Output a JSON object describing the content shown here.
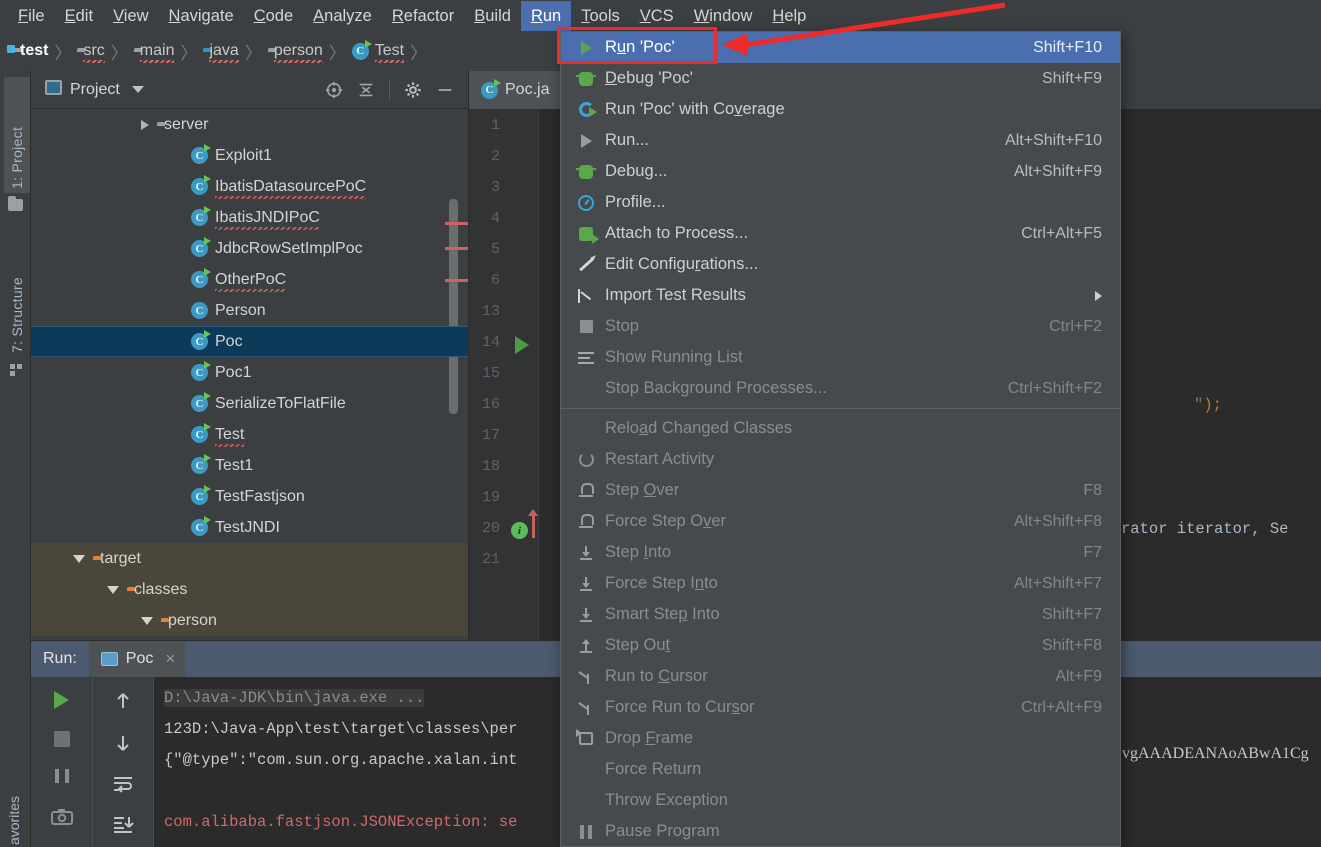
{
  "menubar": {
    "items": [
      {
        "label": "File",
        "mn": "F"
      },
      {
        "label": "Edit",
        "mn": "E"
      },
      {
        "label": "View",
        "mn": "V"
      },
      {
        "label": "Navigate",
        "mn": "N"
      },
      {
        "label": "Code",
        "mn": "C"
      },
      {
        "label": "Analyze",
        "mn": "A"
      },
      {
        "label": "Refactor",
        "mn": "R"
      },
      {
        "label": "Build",
        "mn": "B"
      },
      {
        "label": "Run",
        "mn": "R"
      },
      {
        "label": "Tools",
        "mn": "T"
      },
      {
        "label": "VCS",
        "mn": "V"
      },
      {
        "label": "Window",
        "mn": "W"
      },
      {
        "label": "Help",
        "mn": "H"
      }
    ],
    "active_index": 8
  },
  "breadcrumb": {
    "items": [
      {
        "label": "test",
        "icon": "folder-module-icon"
      },
      {
        "label": "src",
        "icon": "folder-icon"
      },
      {
        "label": "main",
        "icon": "folder-icon"
      },
      {
        "label": "java",
        "icon": "folder-source-icon"
      },
      {
        "label": "person",
        "icon": "folder-package-icon"
      },
      {
        "label": "Test",
        "icon": "java-class-icon"
      }
    ]
  },
  "left_toolbar": {
    "tabs": [
      {
        "label": "1: Project",
        "icon": "project-icon"
      },
      {
        "label": "7: Structure",
        "icon": "structure-icon"
      }
    ],
    "favorites_label": "avorites"
  },
  "project_panel": {
    "title": "Project",
    "dropdown_icon": "chevron-down-icon",
    "toolbar_icons": [
      "locate-icon",
      "collapse-all-icon",
      "settings-gear-icon",
      "hide-icon"
    ],
    "tree": [
      {
        "label": "server",
        "kind": "folder-package",
        "indent": 3,
        "twisty": "right",
        "selected": false
      },
      {
        "label": "Exploit1",
        "kind": "class-run",
        "indent": 4,
        "twisty": "none",
        "selected": false
      },
      {
        "label": "IbatisDatasourcePoC",
        "kind": "class-run",
        "indent": 4,
        "twisty": "none",
        "selected": false,
        "squiggle": true
      },
      {
        "label": "IbatisJNDIPoC",
        "kind": "class-run",
        "indent": 4,
        "twisty": "none",
        "selected": false,
        "squiggle": true
      },
      {
        "label": "JdbcRowSetImplPoc",
        "kind": "class-run",
        "indent": 4,
        "twisty": "none",
        "selected": false
      },
      {
        "label": "OtherPoC",
        "kind": "class-run",
        "indent": 4,
        "twisty": "none",
        "selected": false,
        "squiggle": true
      },
      {
        "label": "Person",
        "kind": "class",
        "indent": 4,
        "twisty": "none",
        "selected": false
      },
      {
        "label": "Poc",
        "kind": "class-run",
        "indent": 4,
        "twisty": "none",
        "selected": true
      },
      {
        "label": "Poc1",
        "kind": "class-run",
        "indent": 4,
        "twisty": "none",
        "selected": false
      },
      {
        "label": "SerializeToFlatFile",
        "kind": "class-run",
        "indent": 4,
        "twisty": "none",
        "selected": false
      },
      {
        "label": "Test",
        "kind": "class-run",
        "indent": 4,
        "twisty": "none",
        "selected": false,
        "squiggle": true
      },
      {
        "label": "Test1",
        "kind": "class-run",
        "indent": 4,
        "twisty": "none",
        "selected": false
      },
      {
        "label": "TestFastjson",
        "kind": "class-run",
        "indent": 4,
        "twisty": "none",
        "selected": false
      },
      {
        "label": "TestJNDI",
        "kind": "class-run",
        "indent": 4,
        "twisty": "none",
        "selected": false
      },
      {
        "label": "target",
        "kind": "folder-orange",
        "indent": 1,
        "twisty": "down",
        "selected": false,
        "highlight": true
      },
      {
        "label": "classes",
        "kind": "folder-orange",
        "indent": 2,
        "twisty": "down",
        "selected": false,
        "highlight": true
      },
      {
        "label": "person",
        "kind": "folder-orange",
        "indent": 3,
        "twisty": "down",
        "selected": false,
        "highlight": true
      }
    ]
  },
  "editor": {
    "tab": {
      "label": "Poc.ja",
      "icon": "java-class-icon"
    },
    "line_numbers": [
      "1",
      "2",
      "3",
      "4",
      "5",
      "6",
      "13",
      "14",
      "15",
      "16",
      "17",
      "18",
      "19",
      "20",
      "21"
    ],
    "gutter_markers": [
      {
        "type": "run-arrow-icon",
        "line": "14"
      },
      {
        "type": "intention-bulb-icon",
        "line": "20"
      },
      {
        "type": "up-arrow-icon",
        "line": "20"
      }
    ],
    "code_fragments": [
      {
        "text": "\");",
        "line": "16"
      },
      {
        "text": "rator iterator, Se",
        "line": "20"
      }
    ]
  },
  "run_menu": {
    "items": [
      {
        "label": "Run 'Poc'",
        "mn_prefix": "R",
        "mn_char": "u",
        "mn_rest": "n 'Poc'",
        "key": "Shift+F10",
        "icon": "run-icon",
        "state": "highlight"
      },
      {
        "label": "Debug 'Poc'",
        "mn_prefix": "",
        "mn_char": "D",
        "mn_rest": "ebug 'Poc'",
        "key": "Shift+F9",
        "icon": "debug-icon",
        "state": "normal"
      },
      {
        "label": "Run 'Poc' with Coverage",
        "mn_prefix": "Run 'Poc' with Co",
        "mn_char": "v",
        "mn_rest": "erage",
        "key": "",
        "icon": "coverage-icon",
        "state": "normal"
      },
      {
        "label": "Run...",
        "mn_prefix": "Run...",
        "mn_char": "",
        "mn_rest": "",
        "key": "Alt+Shift+F10",
        "icon": "run-plain-icon",
        "state": "normal"
      },
      {
        "label": "Debug...",
        "mn_prefix": "Debug...",
        "mn_char": "",
        "mn_rest": "",
        "key": "Alt+Shift+F9",
        "icon": "debug-icon",
        "state": "normal"
      },
      {
        "label": "Profile...",
        "mn_prefix": "Profile...",
        "mn_char": "",
        "mn_rest": "",
        "key": "",
        "icon": "profile-icon",
        "state": "normal"
      },
      {
        "label": "Attach to Process...",
        "mn_prefix": "Attach to Process...",
        "mn_char": "",
        "mn_rest": "",
        "key": "Ctrl+Alt+F5",
        "icon": "attach-process-icon",
        "state": "normal"
      },
      {
        "label": "Edit Configurations...",
        "mn_prefix": "Edit Configu",
        "mn_char": "r",
        "mn_rest": "ations...",
        "key": "",
        "icon": "edit-pencil-icon",
        "state": "normal"
      },
      {
        "label": "Import Test Results",
        "mn_prefix": "Import Test Results",
        "mn_char": "",
        "mn_rest": "",
        "key": "",
        "icon": "import-results-icon",
        "state": "normal",
        "submenu": true
      },
      {
        "label": "Stop",
        "mn_prefix": "Stop",
        "mn_char": "",
        "mn_rest": "",
        "key": "Ctrl+F2",
        "icon": "stop-icon",
        "state": "disabled"
      },
      {
        "label": "Show Running List",
        "mn_prefix": "Show Running List",
        "mn_char": "",
        "mn_rest": "",
        "key": "",
        "icon": "running-list-icon",
        "state": "disabled"
      },
      {
        "label": "Stop Background Processes...",
        "mn_prefix": "Stop Background Processes...",
        "mn_char": "",
        "mn_rest": "",
        "key": "Ctrl+Shift+F2",
        "icon": "none",
        "state": "disabled"
      },
      {
        "separator": true
      },
      {
        "label": "Reload Changed Classes",
        "mn_prefix": "Relo",
        "mn_char": "a",
        "mn_rest": "d Changed Classes",
        "key": "",
        "icon": "none",
        "state": "disabled"
      },
      {
        "label": "Restart Activity",
        "mn_prefix": "Restart Activity",
        "mn_char": "",
        "mn_rest": "",
        "key": "",
        "icon": "restart-icon",
        "state": "disabled"
      },
      {
        "label": "Step Over",
        "mn_prefix": "Step ",
        "mn_char": "O",
        "mn_rest": "ver",
        "key": "F8",
        "icon": "step-over-icon",
        "state": "disabled"
      },
      {
        "label": "Force Step Over",
        "mn_prefix": "Force Step O",
        "mn_char": "v",
        "mn_rest": "er",
        "key": "Alt+Shift+F8",
        "icon": "step-over-icon",
        "state": "disabled"
      },
      {
        "label": "Step Into",
        "mn_prefix": "Step ",
        "mn_char": "I",
        "mn_rest": "nto",
        "key": "F7",
        "icon": "step-into-icon",
        "state": "disabled"
      },
      {
        "label": "Force Step Into",
        "mn_prefix": "Force Step I",
        "mn_char": "n",
        "mn_rest": "to",
        "key": "Alt+Shift+F7",
        "icon": "step-into-icon",
        "state": "disabled"
      },
      {
        "label": "Smart Step Into",
        "mn_prefix": "Smart Ste",
        "mn_char": "p",
        "mn_rest": " Into",
        "key": "Shift+F7",
        "icon": "smart-step-into-icon",
        "state": "disabled"
      },
      {
        "label": "Step Out",
        "mn_prefix": "Step Ou",
        "mn_char": "t",
        "mn_rest": "",
        "key": "Shift+F8",
        "icon": "step-out-icon",
        "state": "disabled"
      },
      {
        "label": "Run to Cursor",
        "mn_prefix": "Run to ",
        "mn_char": "C",
        "mn_rest": "ursor",
        "key": "Alt+F9",
        "icon": "run-to-cursor-icon",
        "state": "disabled"
      },
      {
        "label": "Force Run to Cursor",
        "mn_prefix": "Force Run to Cur",
        "mn_char": "s",
        "mn_rest": "or",
        "key": "Ctrl+Alt+F9",
        "icon": "run-to-cursor-icon",
        "state": "disabled"
      },
      {
        "label": "Drop Frame",
        "mn_prefix": "Drop ",
        "mn_char": "F",
        "mn_rest": "rame",
        "key": "",
        "icon": "drop-frame-icon",
        "state": "disabled"
      },
      {
        "label": "Force Return",
        "mn_prefix": "Force Return",
        "mn_char": "",
        "mn_rest": "",
        "key": "",
        "icon": "none",
        "state": "disabled"
      },
      {
        "label": "Throw Exception",
        "mn_prefix": "Throw Exception",
        "mn_char": "",
        "mn_rest": "",
        "key": "",
        "icon": "none",
        "state": "disabled"
      },
      {
        "label": "Pause Program",
        "mn_prefix": "Pause Program",
        "mn_char": "",
        "mn_rest": "",
        "key": "",
        "icon": "pause-icon",
        "state": "disabled"
      }
    ]
  },
  "run_tool_window": {
    "label": "Run:",
    "tab": {
      "label": "Poc",
      "icon": "run-config-icon",
      "close": "×"
    },
    "toolbar_left": [
      "rerun-icon",
      "stop-icon",
      "pause-icon",
      "screenshot-icon"
    ],
    "toolbar_right": [
      "up-arrow-icon",
      "down-arrow-icon",
      "soft-wrap-icon",
      "scroll-to-end-icon"
    ],
    "console_lines": [
      {
        "text": "D:\\Java-JDK\\bin\\java.exe ...",
        "style": "cmd"
      },
      {
        "text": "123D:\\Java-App\\test\\target\\classes\\per",
        "style": "white"
      },
      {
        "text": "{\"@type\":\"com.sun.org.apache.xalan.int",
        "style": "white"
      },
      {
        "text": "",
        "style": "white"
      },
      {
        "text": "com.alibaba.fastjson.JSONException: se",
        "style": "err"
      }
    ]
  },
  "right_editor_fragments": {
    "base64_text": "vgAAADEANAoABwA1Cg"
  },
  "annotation": {
    "redbox_color": "#ef2a2a",
    "arrow_color": "#ee2b2b"
  },
  "colors": {
    "bg": "#3c3f41",
    "editor_bg": "#2b2b2b",
    "accent_blue": "#4b6eaf",
    "selection": "#0d3a58",
    "menu_bg": "#474a4c"
  }
}
